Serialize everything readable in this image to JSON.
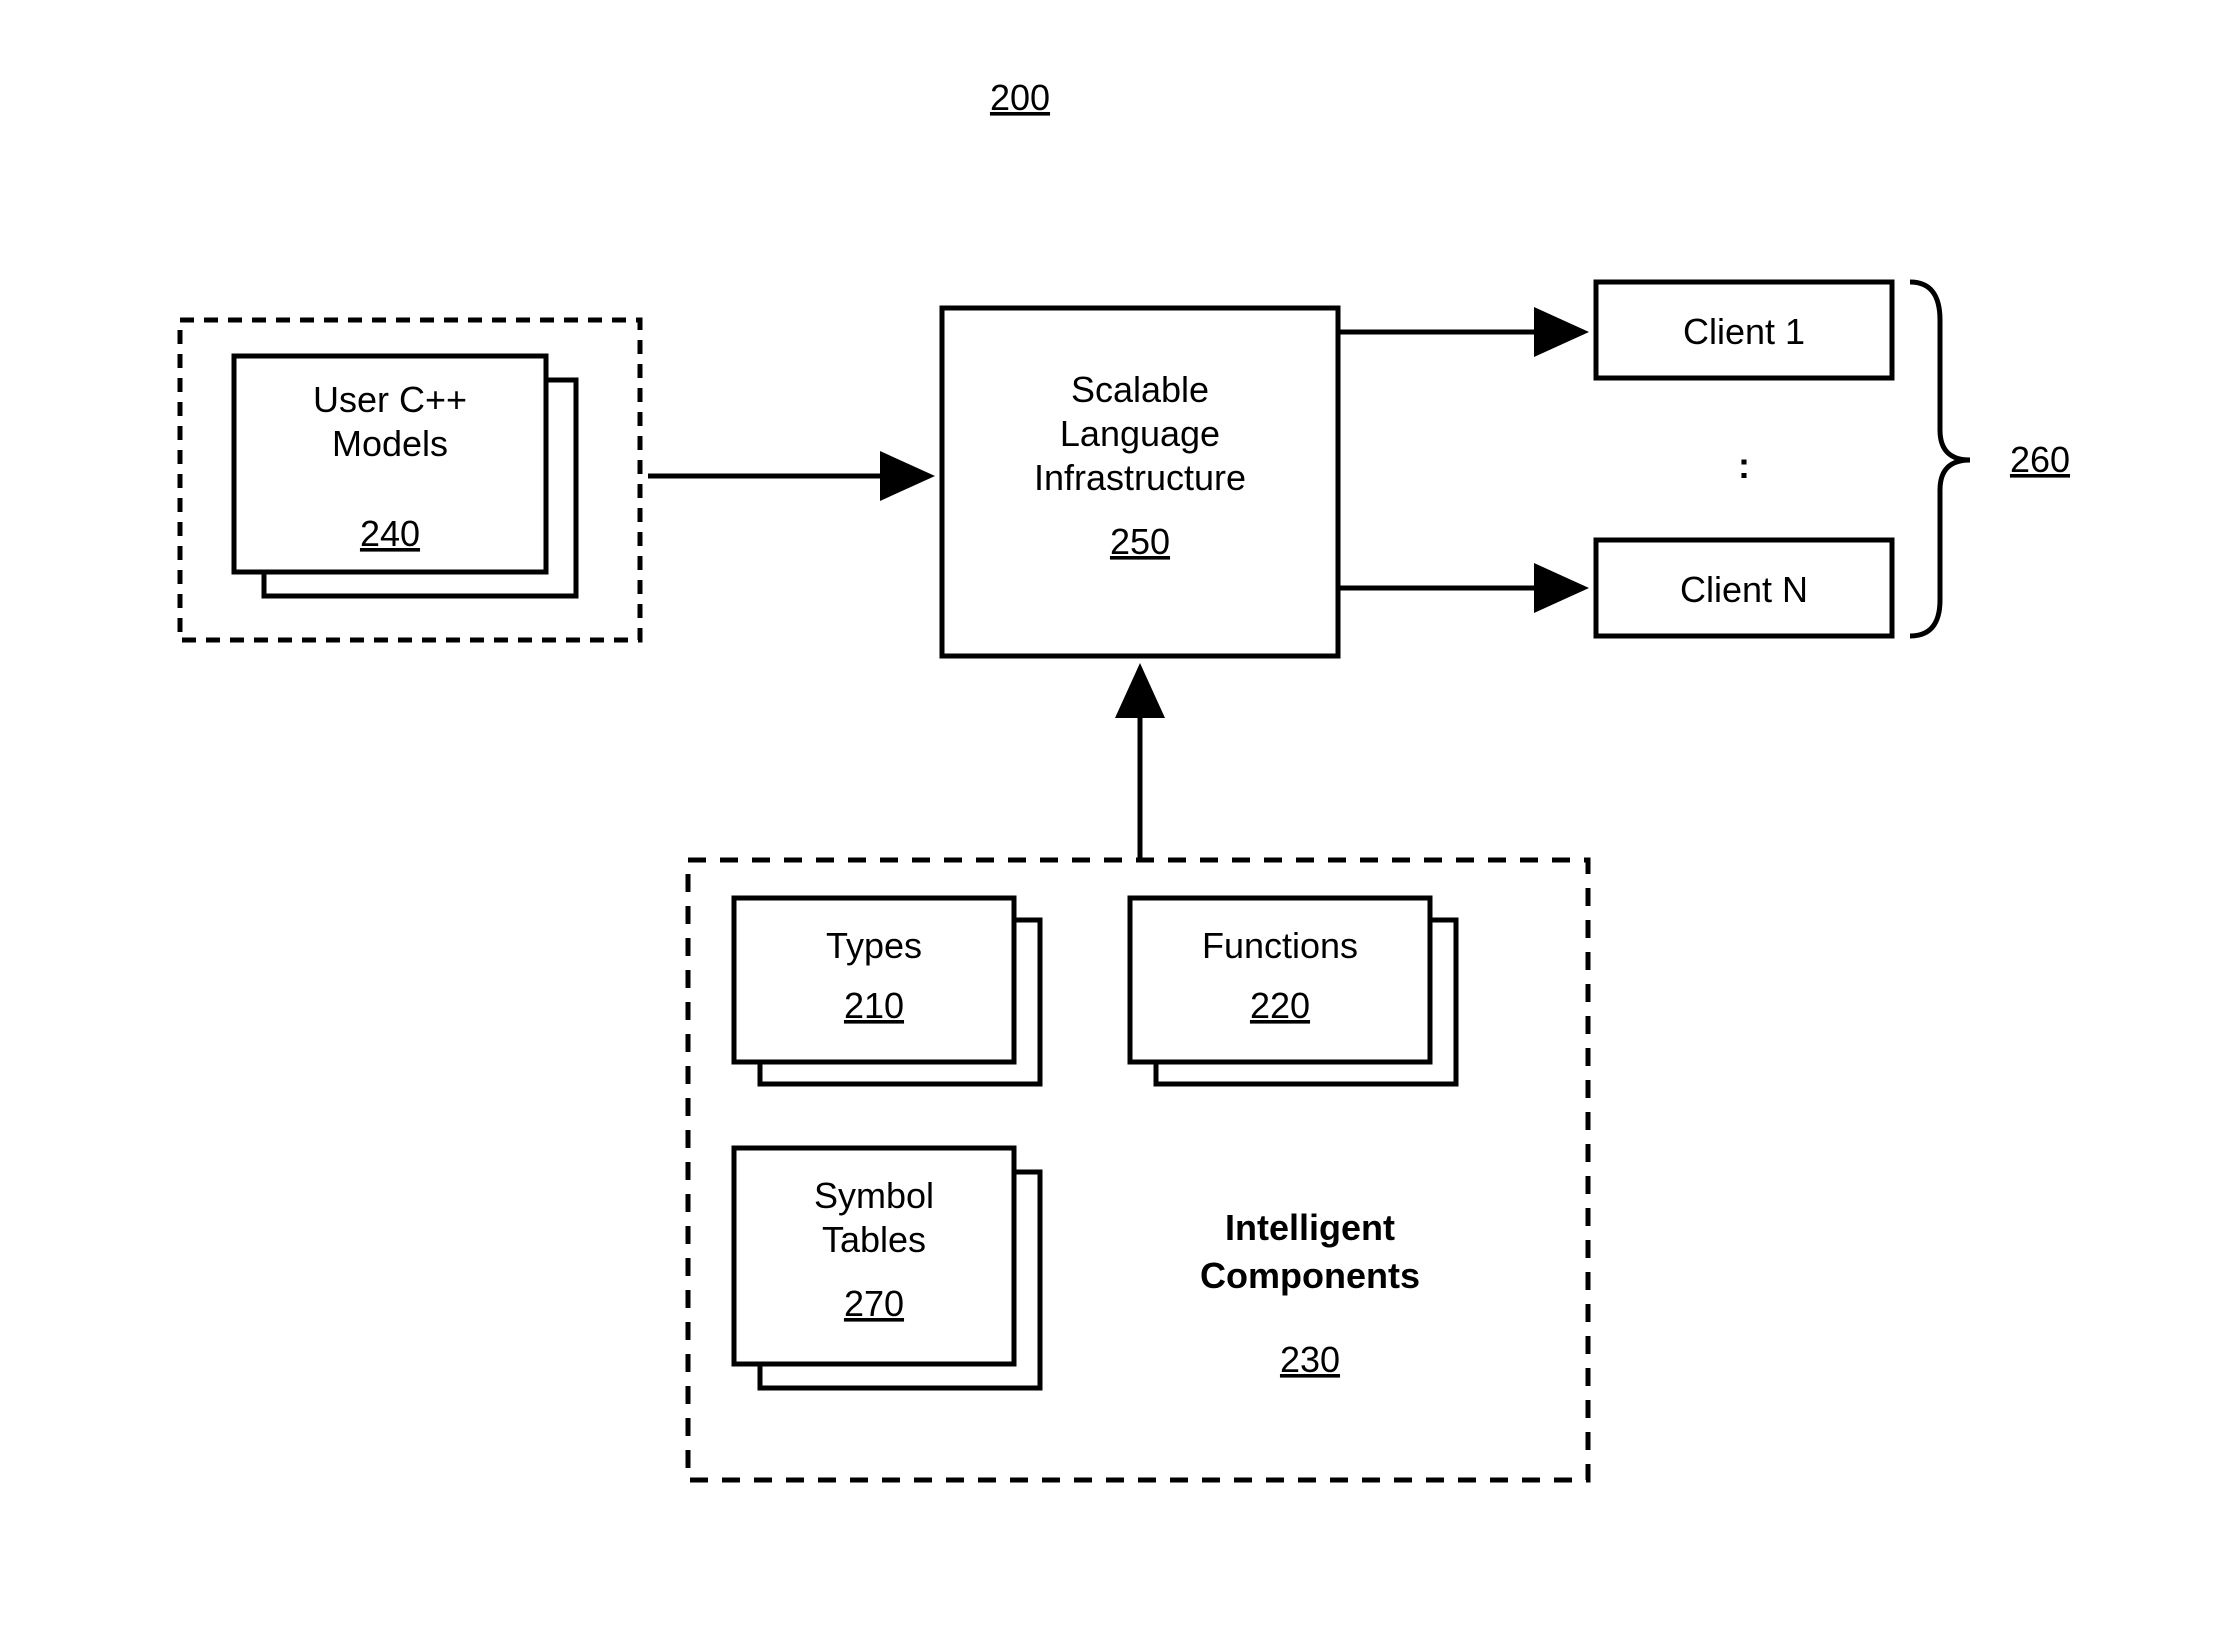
{
  "figureNumber": "200",
  "userModels": {
    "line1": "User C++",
    "line2": "Models",
    "ref": "240"
  },
  "scalable": {
    "line1": "Scalable",
    "line2": "Language",
    "line3": "Infrastructure",
    "ref": "250"
  },
  "clients": {
    "client1": "Client 1",
    "clientN": "Client N",
    "separator": ":",
    "ref": "260"
  },
  "components": {
    "types": {
      "label": "Types",
      "ref": "210"
    },
    "functions": {
      "label": "Functions",
      "ref": "220"
    },
    "symbolTables": {
      "line1": "Symbol",
      "line2": "Tables",
      "ref": "270"
    },
    "title1": "Intelligent",
    "title2": "Components",
    "ref": "230"
  }
}
